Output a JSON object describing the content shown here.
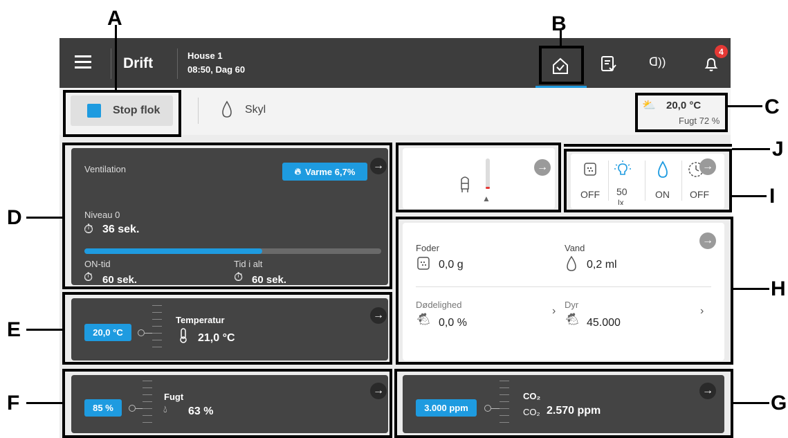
{
  "header": {
    "title": "Drift",
    "house": "House 1",
    "time_day": "08:50, Dag 60",
    "bell_count": "4"
  },
  "toolbar": {
    "stop_label": "Stop flok",
    "rinse_label": "Skyl"
  },
  "weather": {
    "temp": "20,0 °C",
    "humidity": "Fugt 72 %"
  },
  "ventilation": {
    "title": "Ventilation",
    "heat_badge": "Varme 6,7%",
    "level": "Niveau 0",
    "timer": "36 sek.",
    "progress": 0.6,
    "on_label": "ON-tid",
    "on_value": "60 sek.",
    "total_label": "Tid i alt",
    "total_value": "60 sek."
  },
  "temperature": {
    "setpoint": "20,0 °C",
    "label": "Temperatur",
    "value": "21,0 °C"
  },
  "humidity": {
    "setpoint": "85 %",
    "label": "Fugt",
    "value": "63 %"
  },
  "co2": {
    "setpoint": "3.000 ppm",
    "label": "CO₂",
    "unit_label": "CO₂",
    "value": "2.570 ppm"
  },
  "status_icons": {
    "feed_state": "OFF",
    "light_value": "50",
    "light_unit": "lx",
    "water_state": "ON",
    "clock_state": "OFF"
  },
  "production": {
    "feed_label": "Foder",
    "feed_value": "0,0 g",
    "water_label": "Vand",
    "water_value": "0,2 ml",
    "mortality_label": "Dødelighed",
    "mortality_value": "0,0 %",
    "animals_label": "Dyr",
    "animals_value": "45.000"
  },
  "callouts": {
    "a": "A",
    "b": "B",
    "c": "C",
    "d": "D",
    "e": "E",
    "f": "F",
    "g": "G",
    "h": "H",
    "i": "I",
    "j": "J"
  }
}
